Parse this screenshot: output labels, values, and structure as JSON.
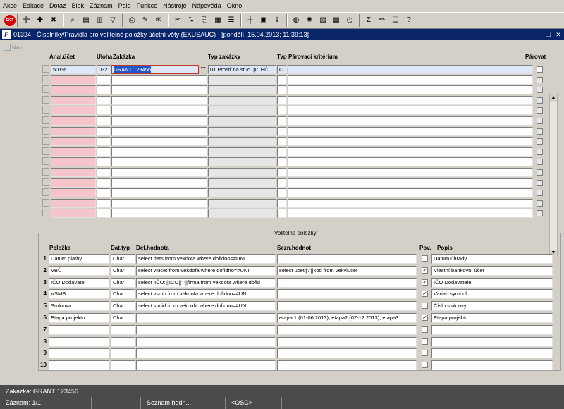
{
  "menu": [
    "Akce",
    "Editace",
    "Dotaz",
    "Blok",
    "Záznam",
    "Pole",
    "Funkce",
    "Nástroje",
    "Nápověda",
    "Okno"
  ],
  "toolbar": {
    "exit_label": "EXIT",
    "icons": [
      "add-record-icon",
      "delete-record-icon",
      "cancel-icon",
      "enter-query-icon",
      "execute-query-icon",
      "cancel-query-icon",
      "filter-icon",
      "print-icon",
      "attach-icon",
      "mail-icon",
      "cut-icon",
      "swap-icon",
      "copy-icon",
      "paste-icon",
      "list-icon",
      "split-icon",
      "report-icon",
      "export-icon",
      "globe-icon",
      "settings-icon",
      "map-icon",
      "calendar-icon",
      "clock-icon",
      "sum-icon",
      "edit-icon",
      "copy-form-icon",
      "help-icon"
    ]
  },
  "title": {
    "text": "01324 - Číselníky/Pravidla pro volitelné položky účetní věty (EKUSAUC) - [pondělí, 15.04.2013; 11:39:13]",
    "icon_letter": "F"
  },
  "nav": {
    "label": "Nav"
  },
  "master": {
    "headers": {
      "anal": "Anal.účet",
      "uloha": "Úloha",
      "zakazka": "Zakázka",
      "typ_zakazky": "Typ zakázky",
      "typ": "Typ",
      "parovaci": "Párovací kritérium",
      "parovat": "Párovat"
    },
    "first_row": {
      "anal": "501%",
      "uloha": "032",
      "zakazka": "GRANT 123456",
      "typ_zakazky": "01 Prostř.na stud. pr. HČ",
      "typ": "C",
      "parovaci": ""
    }
  },
  "detail": {
    "frame_title": "Volitelné položky",
    "headers": {
      "polozka": "Položka",
      "dattyp": "Dat.typ",
      "defhod": "Def.hodnota",
      "sezn": "Sezn.hodnot",
      "pov": "Pov.",
      "popis": "Popis"
    },
    "rows": [
      {
        "n": "1",
        "polozka": "Datum platby",
        "dattyp": "Char",
        "defhod": "select dats from vekdofa where dofidno=#UNI",
        "sezn": "",
        "pov": false,
        "popis": "Datum úhrady"
      },
      {
        "n": "2",
        "polozka": "VBÚ",
        "dattyp": "Char",
        "defhod": "select vlucet from vekdofa where dofidno=#UNI",
        "sezn": "select ucet||'/'||kod from vekvlucet",
        "pov": true,
        "popis": "Vlastní bankovní účet"
      },
      {
        "n": "3",
        "polozka": "IČO Dodavatel",
        "dattyp": "Char",
        "defhod": "select 'IČO:'||ICO||' '||firma from vekdofa where dofid",
        "sezn": "",
        "pov": true,
        "popis": "IČO Dodavatele"
      },
      {
        "n": "4",
        "polozka": "VSMB",
        "dattyp": "Char",
        "defhod": "select vsmb from vekdofa where dofidno=#UNI",
        "sezn": "",
        "pov": true,
        "popis": "Variab.symbol"
      },
      {
        "n": "5",
        "polozka": "Smlouva",
        "dattyp": "Char",
        "defhod": "select smlid from vekdofa where dofidno=#UNI",
        "sezn": "",
        "pov": false,
        "popis": "Číslo smlouvy"
      },
      {
        "n": "6",
        "polozka": "Etapa projektu",
        "dattyp": "Char",
        "defhod": "",
        "sezn": "etapa 1 (01-06 2013), etapa2 (07-12 2013), etapa3",
        "pov": true,
        "popis": "Etapa projektu"
      },
      {
        "n": "7",
        "polozka": "",
        "dattyp": "",
        "defhod": "",
        "sezn": "",
        "pov": false,
        "popis": ""
      },
      {
        "n": "8",
        "polozka": "",
        "dattyp": "",
        "defhod": "",
        "sezn": "",
        "pov": false,
        "popis": ""
      },
      {
        "n": "9",
        "polozka": "",
        "dattyp": "",
        "defhod": "",
        "sezn": "",
        "pov": false,
        "popis": ""
      },
      {
        "n": "10",
        "polozka": "",
        "dattyp": "",
        "defhod": "",
        "sezn": "",
        "pov": false,
        "popis": ""
      }
    ]
  },
  "status": {
    "line1": "Zakázka: GRANT 123456",
    "record": "Záznam: 1/1",
    "list": "Seznam hodn...",
    "osc": "<OSC>"
  },
  "colors": {
    "title_bg": "#0a246a",
    "pink_field": "#f6c5cc",
    "status_bg": "#4b4b4b"
  }
}
